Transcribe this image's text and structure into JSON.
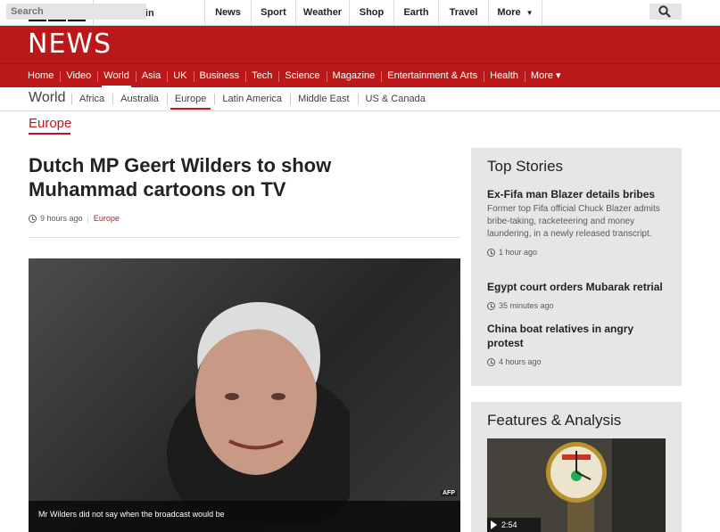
{
  "brand": {
    "logo_letters": [
      "B",
      "B",
      "C"
    ],
    "news_word": "NEWS",
    "accent": "#bb1919"
  },
  "topbar": {
    "signin_label": "Sign in",
    "nav": [
      {
        "label": "News",
        "w": 52
      },
      {
        "label": "Sport",
        "w": 50
      },
      {
        "label": "Weather",
        "w": 60
      },
      {
        "label": "Shop",
        "w": 50
      },
      {
        "label": "Earth",
        "w": 50
      },
      {
        "label": "Travel",
        "w": 56
      },
      {
        "label": "More",
        "w": 60
      }
    ],
    "search_placeholder": "Search"
  },
  "main_nav": [
    "Home",
    "Video",
    "World",
    "Asia",
    "UK",
    "Business",
    "Tech",
    "Science",
    "Magazine",
    "Entertainment & Arts",
    "Health",
    "More ▾"
  ],
  "main_nav_active": "World",
  "sub_nav": {
    "section": "World",
    "links": [
      "Africa",
      "Australia",
      "Europe",
      "Latin America",
      "Middle East",
      "US & Canada"
    ],
    "active": "Europe"
  },
  "breadcrumb": "Europe",
  "article": {
    "headline": "Dutch MP Geert Wilders to show Muhammad cartoons on TV",
    "time": "9 hours ago",
    "tag": "Europe",
    "image_credit": "AFP",
    "caption": "Mr Wilders did not say when the broadcast would be"
  },
  "top_stories": {
    "title": "Top Stories",
    "items": [
      {
        "title": "Ex-Fifa man Blazer details bribes",
        "summary": "Former top Fifa official Chuck Blazer admits bribe-taking, racketeering and money laundering, in a newly released transcript.",
        "time": "1 hour ago"
      },
      {
        "title": "Egypt court orders Mubarak retrial",
        "summary": "",
        "time": "35 minutes ago"
      },
      {
        "title": "China boat relatives in angry protest",
        "summary": "",
        "time": "4 hours ago"
      }
    ]
  },
  "features": {
    "title": "Features & Analysis",
    "video_duration": "2:54"
  }
}
